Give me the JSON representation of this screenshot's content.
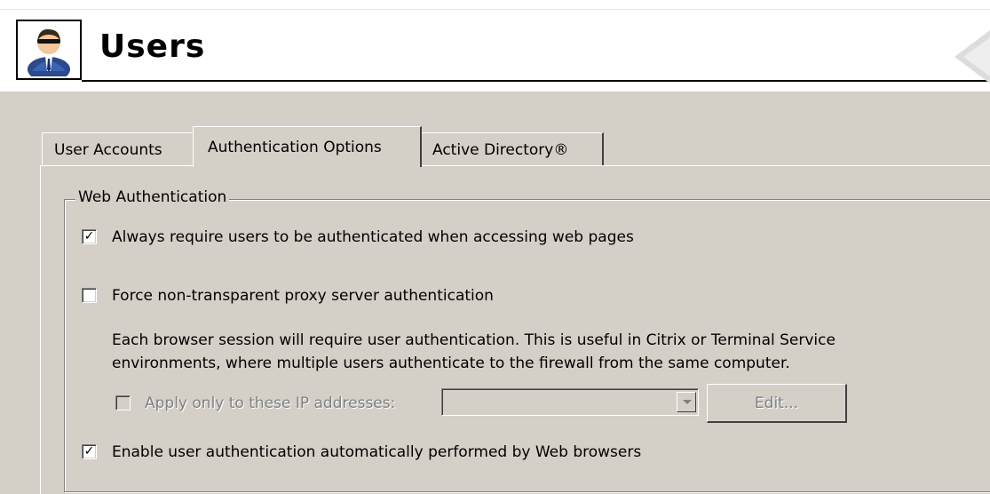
{
  "header": {
    "title": "Users",
    "icon": "user-icon"
  },
  "tabs": [
    {
      "label": "User Accounts",
      "active": false
    },
    {
      "label": "Authentication Options",
      "active": true
    },
    {
      "label": "Active Directory®",
      "active": false
    }
  ],
  "web_auth": {
    "group_label": "Web Authentication",
    "always_require": {
      "label": "Always require users to be authenticated when accessing web pages",
      "checked": true
    },
    "force_proxy": {
      "label": "Force non-transparent proxy server authentication",
      "checked": false
    },
    "description_line1": "Each browser session will require user authentication. This is useful in Citrix or Terminal Service",
    "description_line2": "environments, where multiple users authenticate to the firewall from the same computer.",
    "apply_only": {
      "label": "Apply only to these IP addresses:",
      "checked": false,
      "disabled": true
    },
    "ip_select_value": "",
    "edit_button": "Edit...",
    "enable_browser_auth": {
      "label": "Enable user authentication automatically performed by Web browsers",
      "checked": true
    }
  },
  "colors": {
    "window_bg": "#d4d0c8",
    "header_bg": "#ffffff",
    "disabled_text": "#808080"
  }
}
